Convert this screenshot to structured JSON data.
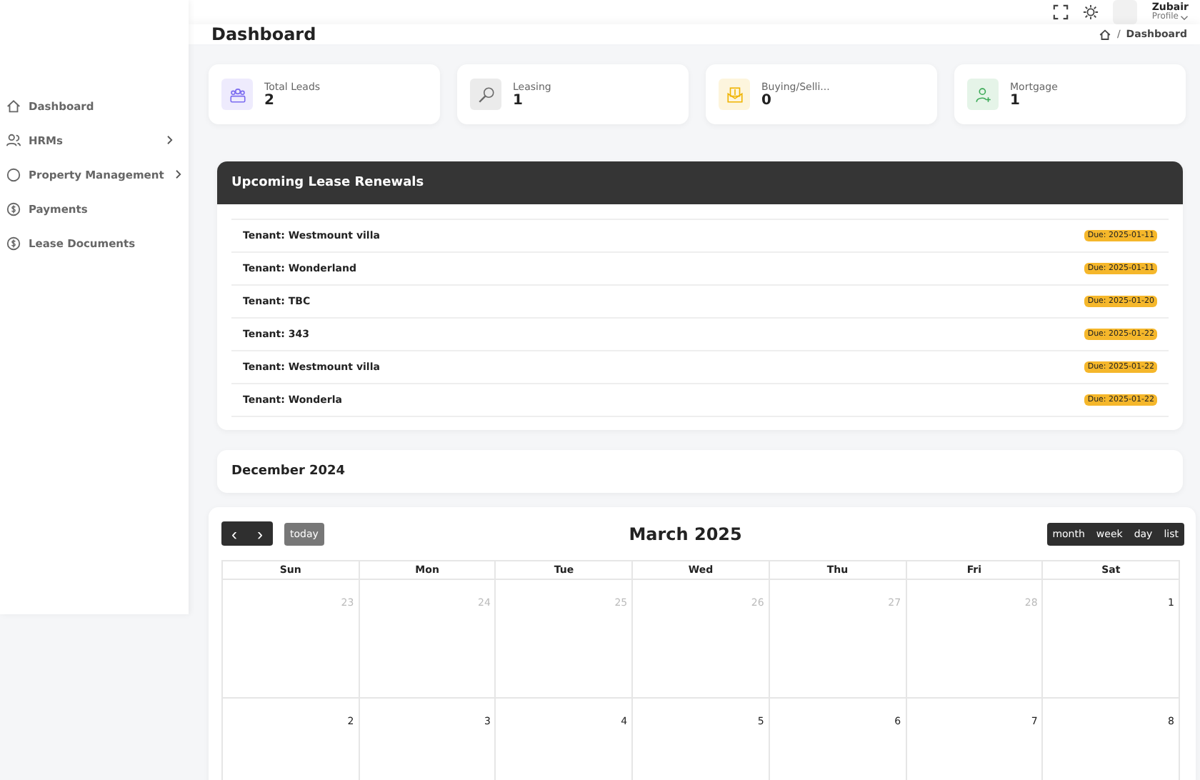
{
  "header": {
    "user_name": "Zubair",
    "user_role": "Profile"
  },
  "sidebar": {
    "items": [
      {
        "label": "Dashboard",
        "has_submenu": false
      },
      {
        "label": "HRMs",
        "has_submenu": true
      },
      {
        "label": "Property Management",
        "has_submenu": true
      },
      {
        "label": "Payments",
        "has_submenu": false
      },
      {
        "label": "Lease Documents",
        "has_submenu": false
      }
    ]
  },
  "page": {
    "title": "Dashboard",
    "breadcrumb_separator": "/",
    "breadcrumb": "Dashboard"
  },
  "stats": [
    {
      "label": "Total Leads",
      "value": "2",
      "color": "#7c6cf0"
    },
    {
      "label": "Leasing",
      "value": "1",
      "color": "#6b6b6b"
    },
    {
      "label": "Buying/Selli...",
      "value": "0",
      "color": "#f0b400"
    },
    {
      "label": "Mortgage",
      "value": "1",
      "color": "#3aa955"
    }
  ],
  "renewals": {
    "title": "Upcoming Lease Renewals",
    "items": [
      {
        "tenant": "Tenant: Westmount villa",
        "due": "Due: 2025-01-11"
      },
      {
        "tenant": "Tenant: Wonderland",
        "due": "Due: 2025-01-11"
      },
      {
        "tenant": "Tenant: TBC",
        "due": "Due: 2025-01-20"
      },
      {
        "tenant": "Tenant: 343",
        "due": "Due: 2025-01-22"
      },
      {
        "tenant": "Tenant: Westmount villa",
        "due": "Due: 2025-01-22"
      },
      {
        "tenant": "Tenant: Wonderla",
        "due": "Due: 2025-01-22"
      }
    ]
  },
  "month_card": {
    "title": "December 2024"
  },
  "calendar": {
    "title": "March 2025",
    "today_label": "today",
    "prev": "‹",
    "next": "›",
    "views": [
      "month",
      "week",
      "day",
      "list"
    ],
    "weekdays": [
      "Sun",
      "Mon",
      "Tue",
      "Wed",
      "Thu",
      "Fri",
      "Sat"
    ],
    "weeks": [
      [
        {
          "day": "23",
          "muted": true
        },
        {
          "day": "24",
          "muted": true
        },
        {
          "day": "25",
          "muted": true
        },
        {
          "day": "26",
          "muted": true
        },
        {
          "day": "27",
          "muted": true
        },
        {
          "day": "28",
          "muted": true
        },
        {
          "day": "1",
          "muted": false
        }
      ],
      [
        {
          "day": "2",
          "muted": false
        },
        {
          "day": "3",
          "muted": false
        },
        {
          "day": "4",
          "muted": false
        },
        {
          "day": "5",
          "muted": false
        },
        {
          "day": "6",
          "muted": false
        },
        {
          "day": "7",
          "muted": false
        },
        {
          "day": "8",
          "muted": false
        }
      ]
    ]
  }
}
